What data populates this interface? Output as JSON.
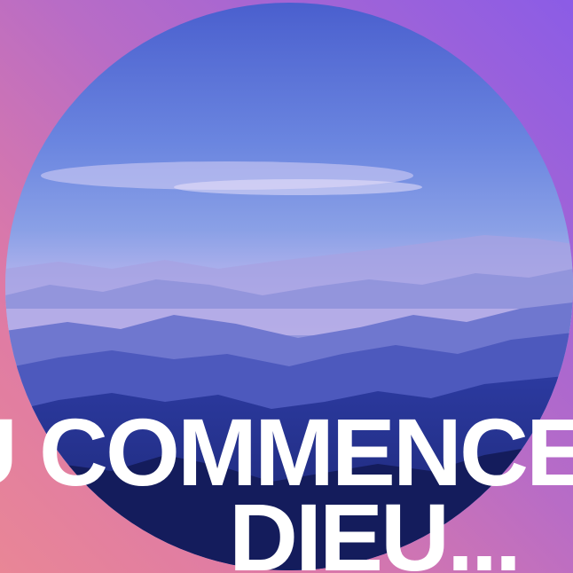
{
  "headline": {
    "line1": "U COMMENCE",
    "line2": "DIEU..."
  },
  "colors": {
    "background_start": "#8b5ce6",
    "background_end": "#e98696",
    "text": "#ffffff",
    "sky_top": "#4e63cf",
    "mist": "#d9c3f0"
  },
  "image": {
    "subject": "misty-mountain-ridges"
  }
}
